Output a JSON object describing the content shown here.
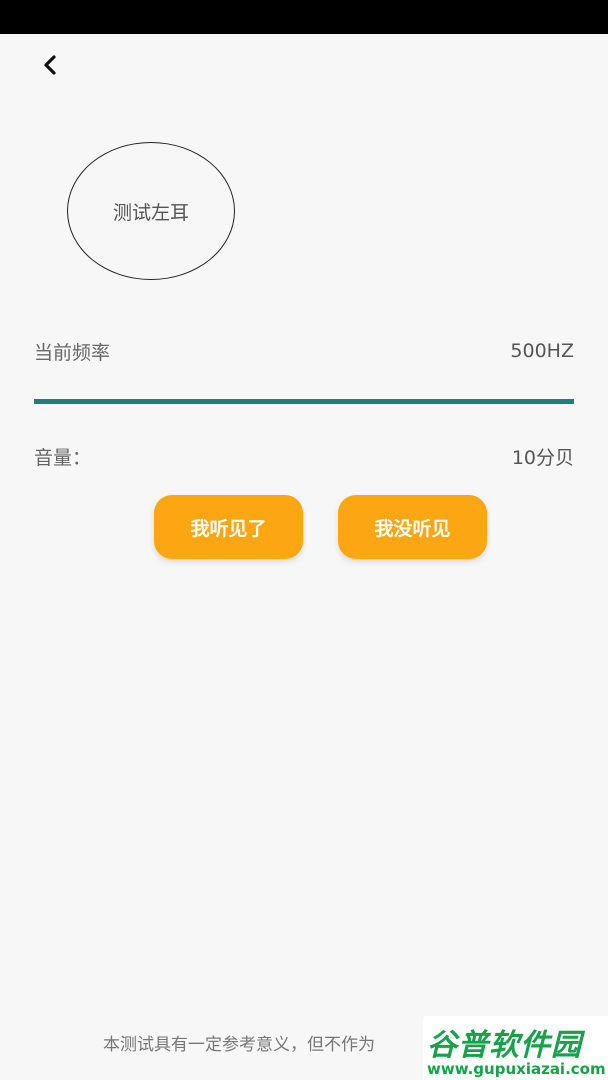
{
  "header": {
    "back_icon": "chevron-left-icon"
  },
  "ear_test": {
    "label": "测试左耳"
  },
  "frequency": {
    "label": "当前频率",
    "value": "500HZ",
    "slider_color": "#1e8078"
  },
  "volume": {
    "label": "音量：",
    "value": "10分贝"
  },
  "actions": {
    "heard_label": "我听见了",
    "not_heard_label": "我没听见",
    "button_color": "#fba612"
  },
  "footer": {
    "disclaimer": "本测试具有一定参考意义，但不作为"
  },
  "watermark": {
    "logo_text": "谷普软件园",
    "url": "www.gupuxiazai.com"
  }
}
